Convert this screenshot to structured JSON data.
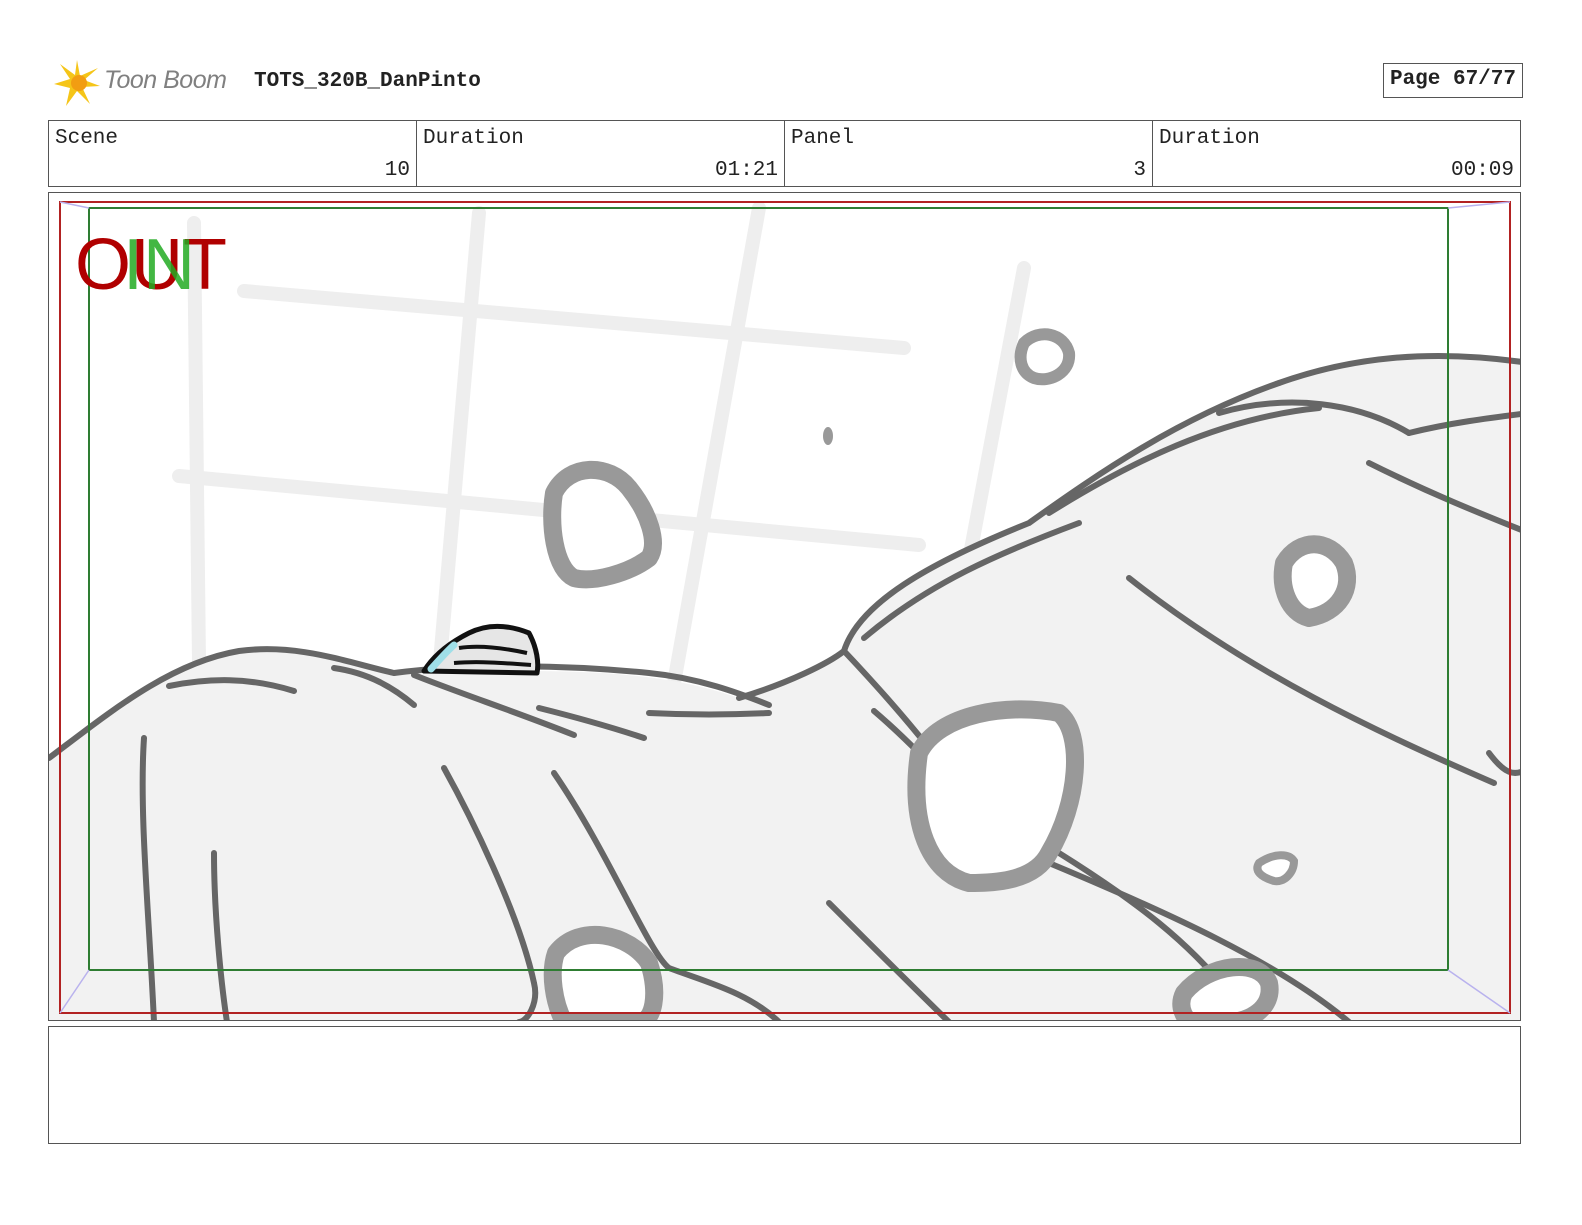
{
  "header": {
    "brand": "Toon Boom",
    "title": "TOTS_320B_DanPinto",
    "page": "Page 67/77"
  },
  "info": [
    {
      "label": "Scene",
      "value": "10"
    },
    {
      "label": "Duration",
      "value": "01:21"
    },
    {
      "label": "Panel",
      "value": "3"
    },
    {
      "label": "Duration",
      "value": "00:09"
    }
  ],
  "panel": {
    "overlay_out": "OUT",
    "overlay_in": "IN",
    "colors": {
      "safe_frame": "#b22222",
      "action_frame": "#2e7d32",
      "sketch": "#666666",
      "spots": "#999999"
    }
  },
  "notes": ""
}
